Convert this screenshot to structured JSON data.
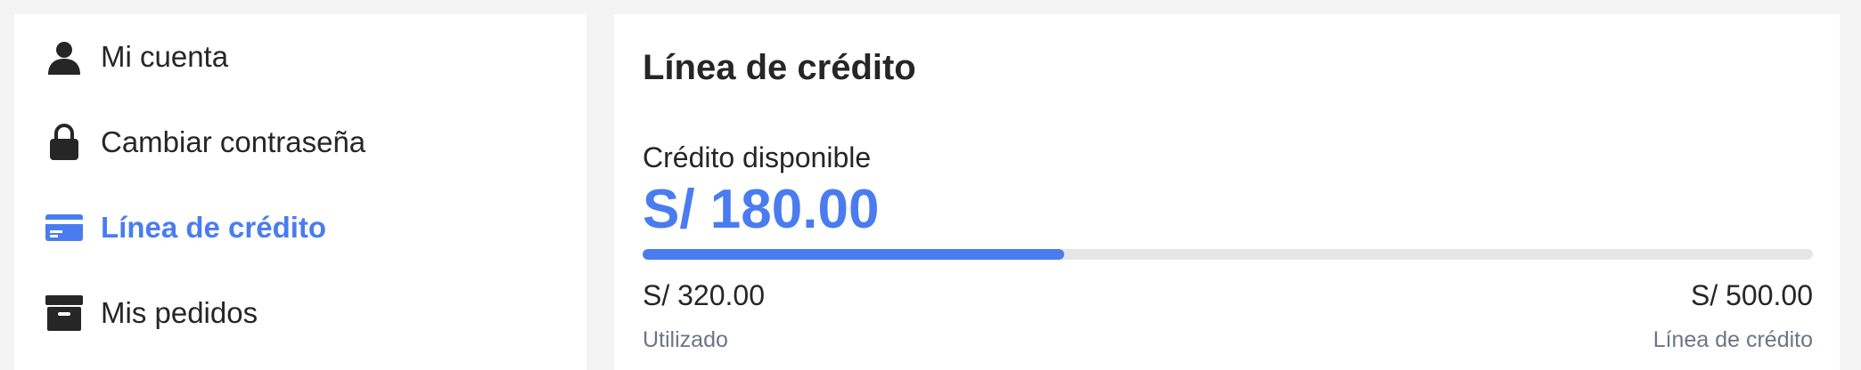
{
  "sidebar": {
    "items": [
      {
        "label": "Mi cuenta",
        "icon": "user-icon",
        "active": false
      },
      {
        "label": "Cambiar contraseña",
        "icon": "lock-icon",
        "active": false
      },
      {
        "label": "Línea de crédito",
        "icon": "credit-card-icon",
        "active": true
      },
      {
        "label": "Mis pedidos",
        "icon": "archive-box-icon",
        "active": false
      }
    ]
  },
  "main": {
    "title": "Línea de crédito",
    "available_label": "Crédito disponible",
    "available_amount": "S/ 180.00",
    "used_amount": "S/ 320.00",
    "used_caption": "Utilizado",
    "limit_amount": "S/ 500.00",
    "limit_caption": "Línea de crédito",
    "usage_fraction": 0.36
  },
  "colors": {
    "accent": "#4a7cf0",
    "text": "#262626",
    "muted": "#6b7585",
    "track": "#e6e6e6",
    "background": "#f4f4f4"
  }
}
